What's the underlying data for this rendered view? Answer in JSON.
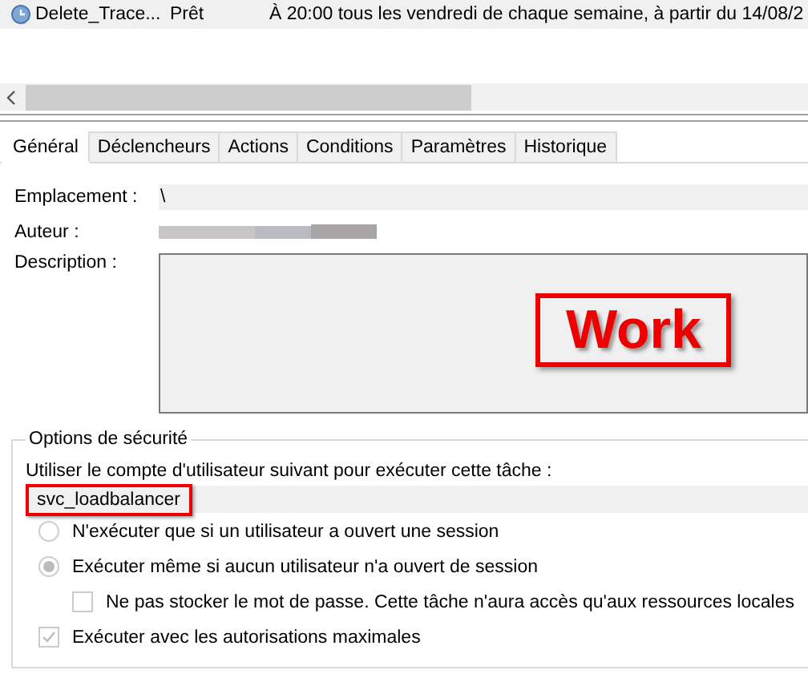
{
  "task_list": {
    "rows": [
      {
        "name": "Delete_Trace...",
        "status": "Prêt",
        "trigger": "À 20:00 tous les vendredi de chaque semaine, à partir du 14/08/2",
        "selected": true
      }
    ]
  },
  "tabs": [
    {
      "label": "Général",
      "selected": true
    },
    {
      "label": "Déclencheurs",
      "selected": false
    },
    {
      "label": "Actions",
      "selected": false
    },
    {
      "label": "Conditions",
      "selected": false
    },
    {
      "label": "Paramètres",
      "selected": false
    },
    {
      "label": "Historique",
      "selected": false
    }
  ],
  "general": {
    "location_label": "Emplacement :",
    "location": "\\",
    "author_label": "Auteur :",
    "author_redacted": true,
    "description_label": "Description :",
    "description_annotation": "Work"
  },
  "security": {
    "title": "Options de sécurité",
    "account_label": "Utiliser le compte d'utilisateur suivant pour exécuter cette tâche :",
    "account": "svc_loadbalancer",
    "account_highlighted": true,
    "options": [
      {
        "kind": "radio",
        "label": "N'exécuter que si un utilisateur a ouvert une session",
        "selected": false,
        "disabled": true
      },
      {
        "kind": "radio",
        "label": "Exécuter même si aucun utilisateur n'a ouvert de session",
        "selected": true,
        "disabled": true,
        "children": [
          {
            "kind": "checkbox",
            "label": "Ne pas stocker le mot de passe. Cette tâche n'aura accès qu'aux ressources locales",
            "checked": false,
            "disabled": true
          }
        ]
      },
      {
        "kind": "checkbox",
        "label": "Exécuter avec les autorisations maximales",
        "checked": true,
        "disabled": true
      }
    ]
  }
}
